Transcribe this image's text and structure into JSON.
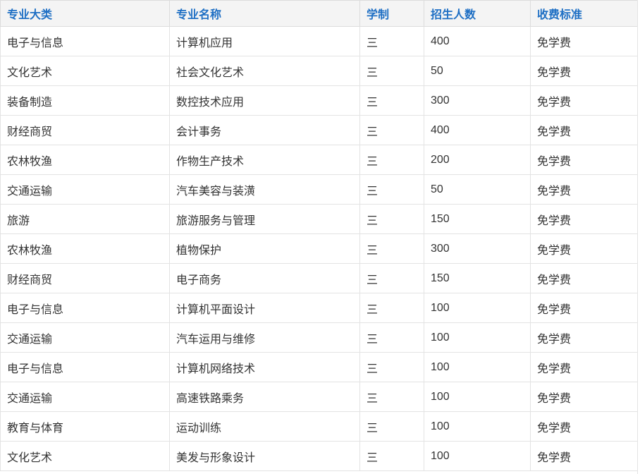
{
  "table": {
    "headers": [
      "专业大类",
      "专业名称",
      "学制",
      "招生人数",
      "收费标准"
    ],
    "rows": [
      [
        "电子与信息",
        "计算机应用",
        "三",
        "400",
        "免学费"
      ],
      [
        "文化艺术",
        "社会文化艺术",
        "三",
        "50",
        "免学费"
      ],
      [
        "装备制造",
        "数控技术应用",
        "三",
        "300",
        "免学费"
      ],
      [
        "财经商贸",
        "会计事务",
        "三",
        "400",
        "免学费"
      ],
      [
        "农林牧渔",
        "作物生产技术",
        "三",
        "200",
        "免学费"
      ],
      [
        "交通运输",
        "汽车美容与装潢",
        "三",
        "50",
        "免学费"
      ],
      [
        "旅游",
        "旅游服务与管理",
        "三",
        "150",
        "免学费"
      ],
      [
        "农林牧渔",
        "植物保护",
        "三",
        "300",
        "免学费"
      ],
      [
        "财经商贸",
        "电子商务",
        "三",
        "150",
        "免学费"
      ],
      [
        "电子与信息",
        "计算机平面设计",
        "三",
        "100",
        "免学费"
      ],
      [
        "交通运输",
        "汽车运用与维修",
        "三",
        "100",
        "免学费"
      ],
      [
        "电子与信息",
        "计算机网络技术",
        "三",
        "100",
        "免学费"
      ],
      [
        "交通运输",
        "高速铁路乘务",
        "三",
        "100",
        "免学费"
      ],
      [
        "教育与体育",
        "运动训练",
        "三",
        "100",
        "免学费"
      ],
      [
        "文化艺术",
        "美发与形象设计",
        "三",
        "100",
        "免学费"
      ]
    ]
  },
  "colors": {
    "header_text": "#1e6fc4",
    "header_bg": "#f4f4f4",
    "cell_text": "#333333",
    "border": "#e3e3e3"
  }
}
